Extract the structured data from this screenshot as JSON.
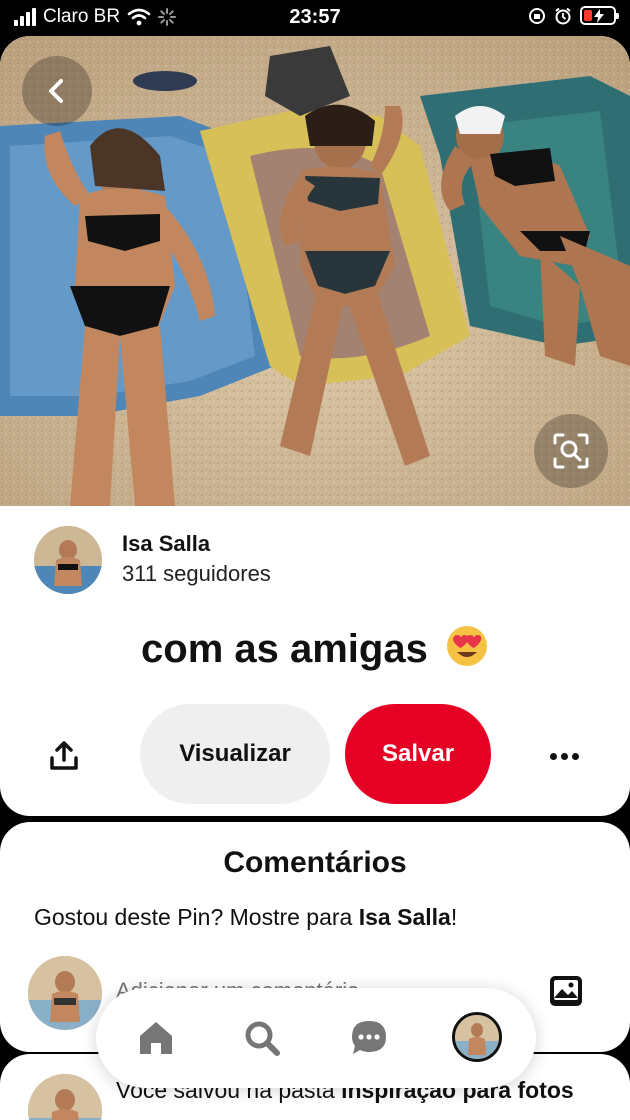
{
  "status_bar": {
    "carrier": "Claro BR",
    "time": "23:57",
    "battery_color": "#ff3b30"
  },
  "pin": {
    "icons": {
      "back": "chevron-left-icon",
      "lens": "visual-search-icon",
      "share": "share-upload-icon",
      "more": "more-horizontal-icon"
    },
    "author": {
      "name": "Isa Salla",
      "followers": "311 seguidores"
    },
    "title": "com as amigas",
    "title_emoji": "heart-eyes-emoji",
    "actions": {
      "visit_label": "Visualizar",
      "save_label": "Salvar",
      "save_color": "#e60023"
    }
  },
  "comments": {
    "title": "Comentários",
    "prompt_prefix": "Gostou deste Pin? Mostre para ",
    "prompt_name": "Isa Salla",
    "prompt_suffix": "!",
    "input_placeholder": "Adicionar um comentário",
    "image_icon": "image-icon"
  },
  "saved_notice": {
    "prefix": "Você salvou na pasta ",
    "board": "inspiração para fotos"
  },
  "bottom_nav": {
    "items": [
      "home-icon",
      "search-icon",
      "messages-icon",
      "profile-avatar"
    ]
  }
}
